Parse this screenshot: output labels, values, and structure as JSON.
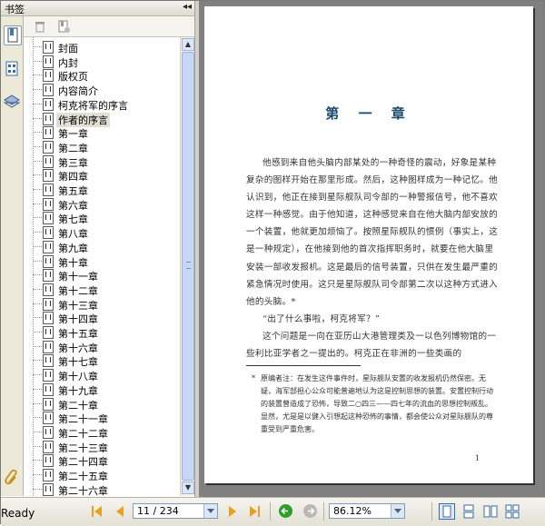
{
  "panel": {
    "title": "书签",
    "bookmarks": [
      "封面",
      "内封",
      "版权页",
      "内容简介",
      "柯克将军的序言",
      "作者的序言",
      "第一章",
      "第二章",
      "第三章",
      "第四章",
      "第五章",
      "第六章",
      "第七章",
      "第八章",
      "第九章",
      "第十章",
      "第十一章",
      "第十二章",
      "第十三章",
      "第十四章",
      "第十五章",
      "第十六章",
      "第十七章",
      "第十八章",
      "第十九章",
      "第二十章",
      "第二十一章",
      "第二十二章",
      "第二十三章",
      "第二十四章",
      "第二十五章",
      "第二十六章"
    ],
    "selected_index": 5
  },
  "document": {
    "chapter_title": "第 一 章",
    "paragraph1": "他感到来自他头脑内部某处的一种奇怪的震动，好象是某种复杂的图样开始在那里形成。然后，这种图样成为一种记忆。他认识到，他正在接到星际舰队司令部的一种警报信号，他不喜欢这样一种感觉。由于他知道，这种感觉来自在他大脑内部安放的一个装置，他就更加烦恼了。按照星际舰队的惯例（事实上，这是一种规定），在他接到他的首次指挥职务时，就要在他大脑里安装一部收发报机。这是最后的信号装置，只供在发生最严重的紧急情况时使用。这只是星际舰队司令部第二次以这种方式进入他的头脑。*",
    "dialogue": "“出了什么事啦，柯克将军？”",
    "paragraph2": "这个问题是一向在亚历山大港管理类及一以色列博物馆的一些利比亚学者之一提出的。柯克正在非洲的一些类画的",
    "footnote_mark": "*",
    "footnote": "原编者注：在发生这件事件时，星际舰队安置的收发报机仍然保密。无疑，海军部担心公众可能普遍地认为这是控制思想的装置。安置控制行动的装置曾造成了恐怖，导致二○四三——四七年的流血的思想控制叛乱。显然，尤是是以健入引想起这种恐怖的事情，都会使公众对星际舰队的尊重受到严重危害。",
    "page_number": "1"
  },
  "status": {
    "ready": "Ready",
    "page_field": "11 / 234",
    "zoom_field": "86.12%"
  },
  "colors": {
    "accent_nav": "#e8a020",
    "back_green": "#2aa02a",
    "chapter_title": "#1a4a6a"
  }
}
